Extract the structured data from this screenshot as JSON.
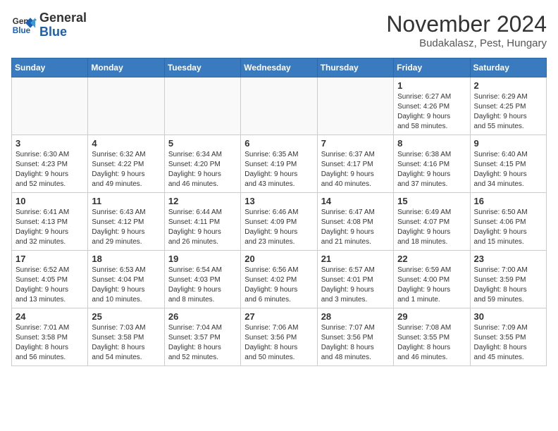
{
  "header": {
    "logo_line1": "General",
    "logo_line2": "Blue",
    "month": "November 2024",
    "location": "Budakalasz, Pest, Hungary"
  },
  "weekdays": [
    "Sunday",
    "Monday",
    "Tuesday",
    "Wednesday",
    "Thursday",
    "Friday",
    "Saturday"
  ],
  "weeks": [
    [
      {
        "day": "",
        "detail": ""
      },
      {
        "day": "",
        "detail": ""
      },
      {
        "day": "",
        "detail": ""
      },
      {
        "day": "",
        "detail": ""
      },
      {
        "day": "",
        "detail": ""
      },
      {
        "day": "1",
        "detail": "Sunrise: 6:27 AM\nSunset: 4:26 PM\nDaylight: 9 hours\nand 58 minutes."
      },
      {
        "day": "2",
        "detail": "Sunrise: 6:29 AM\nSunset: 4:25 PM\nDaylight: 9 hours\nand 55 minutes."
      }
    ],
    [
      {
        "day": "3",
        "detail": "Sunrise: 6:30 AM\nSunset: 4:23 PM\nDaylight: 9 hours\nand 52 minutes."
      },
      {
        "day": "4",
        "detail": "Sunrise: 6:32 AM\nSunset: 4:22 PM\nDaylight: 9 hours\nand 49 minutes."
      },
      {
        "day": "5",
        "detail": "Sunrise: 6:34 AM\nSunset: 4:20 PM\nDaylight: 9 hours\nand 46 minutes."
      },
      {
        "day": "6",
        "detail": "Sunrise: 6:35 AM\nSunset: 4:19 PM\nDaylight: 9 hours\nand 43 minutes."
      },
      {
        "day": "7",
        "detail": "Sunrise: 6:37 AM\nSunset: 4:17 PM\nDaylight: 9 hours\nand 40 minutes."
      },
      {
        "day": "8",
        "detail": "Sunrise: 6:38 AM\nSunset: 4:16 PM\nDaylight: 9 hours\nand 37 minutes."
      },
      {
        "day": "9",
        "detail": "Sunrise: 6:40 AM\nSunset: 4:15 PM\nDaylight: 9 hours\nand 34 minutes."
      }
    ],
    [
      {
        "day": "10",
        "detail": "Sunrise: 6:41 AM\nSunset: 4:13 PM\nDaylight: 9 hours\nand 32 minutes."
      },
      {
        "day": "11",
        "detail": "Sunrise: 6:43 AM\nSunset: 4:12 PM\nDaylight: 9 hours\nand 29 minutes."
      },
      {
        "day": "12",
        "detail": "Sunrise: 6:44 AM\nSunset: 4:11 PM\nDaylight: 9 hours\nand 26 minutes."
      },
      {
        "day": "13",
        "detail": "Sunrise: 6:46 AM\nSunset: 4:09 PM\nDaylight: 9 hours\nand 23 minutes."
      },
      {
        "day": "14",
        "detail": "Sunrise: 6:47 AM\nSunset: 4:08 PM\nDaylight: 9 hours\nand 21 minutes."
      },
      {
        "day": "15",
        "detail": "Sunrise: 6:49 AM\nSunset: 4:07 PM\nDaylight: 9 hours\nand 18 minutes."
      },
      {
        "day": "16",
        "detail": "Sunrise: 6:50 AM\nSunset: 4:06 PM\nDaylight: 9 hours\nand 15 minutes."
      }
    ],
    [
      {
        "day": "17",
        "detail": "Sunrise: 6:52 AM\nSunset: 4:05 PM\nDaylight: 9 hours\nand 13 minutes."
      },
      {
        "day": "18",
        "detail": "Sunrise: 6:53 AM\nSunset: 4:04 PM\nDaylight: 9 hours\nand 10 minutes."
      },
      {
        "day": "19",
        "detail": "Sunrise: 6:54 AM\nSunset: 4:03 PM\nDaylight: 9 hours\nand 8 minutes."
      },
      {
        "day": "20",
        "detail": "Sunrise: 6:56 AM\nSunset: 4:02 PM\nDaylight: 9 hours\nand 6 minutes."
      },
      {
        "day": "21",
        "detail": "Sunrise: 6:57 AM\nSunset: 4:01 PM\nDaylight: 9 hours\nand 3 minutes."
      },
      {
        "day": "22",
        "detail": "Sunrise: 6:59 AM\nSunset: 4:00 PM\nDaylight: 9 hours\nand 1 minute."
      },
      {
        "day": "23",
        "detail": "Sunrise: 7:00 AM\nSunset: 3:59 PM\nDaylight: 8 hours\nand 59 minutes."
      }
    ],
    [
      {
        "day": "24",
        "detail": "Sunrise: 7:01 AM\nSunset: 3:58 PM\nDaylight: 8 hours\nand 56 minutes."
      },
      {
        "day": "25",
        "detail": "Sunrise: 7:03 AM\nSunset: 3:58 PM\nDaylight: 8 hours\nand 54 minutes."
      },
      {
        "day": "26",
        "detail": "Sunrise: 7:04 AM\nSunset: 3:57 PM\nDaylight: 8 hours\nand 52 minutes."
      },
      {
        "day": "27",
        "detail": "Sunrise: 7:06 AM\nSunset: 3:56 PM\nDaylight: 8 hours\nand 50 minutes."
      },
      {
        "day": "28",
        "detail": "Sunrise: 7:07 AM\nSunset: 3:56 PM\nDaylight: 8 hours\nand 48 minutes."
      },
      {
        "day": "29",
        "detail": "Sunrise: 7:08 AM\nSunset: 3:55 PM\nDaylight: 8 hours\nand 46 minutes."
      },
      {
        "day": "30",
        "detail": "Sunrise: 7:09 AM\nSunset: 3:55 PM\nDaylight: 8 hours\nand 45 minutes."
      }
    ]
  ]
}
